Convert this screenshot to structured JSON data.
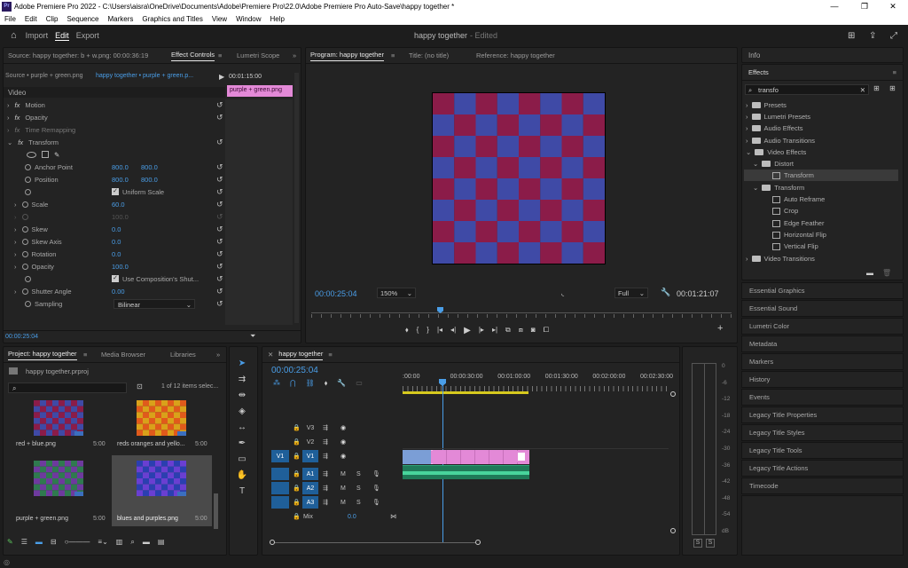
{
  "window": {
    "title": "Adobe Premiere Pro 2022 - C:\\Users\\aisra\\OneDrive\\Documents\\Adobe\\Premiere Pro\\22.0\\Adobe Premiere Pro Auto-Save\\happy together *"
  },
  "menu": [
    "File",
    "Edit",
    "Clip",
    "Sequence",
    "Markers",
    "Graphics and Titles",
    "View",
    "Window",
    "Help"
  ],
  "workspace": {
    "import": "Import",
    "edit": "Edit",
    "export": "Export",
    "project": "happy together",
    "status": "- Edited"
  },
  "effect_controls": {
    "source": "Source: happy together: b + w.png: 00:00:36:19",
    "tab_effect": "Effect Controls",
    "tab_lumetri": "Lumetri Scope",
    "crumb_source": "Source • purple + green.png",
    "crumb_seq": "happy together • purple + green.p...",
    "mini_time": "00:01:15:00",
    "clip": "purple + green.png",
    "video": "Video",
    "motion": "Motion",
    "opacity": "Opacity",
    "time_remap": "Time Remapping",
    "transform": "Transform",
    "anchor": "Anchor Point",
    "anchor_x": "800.0",
    "anchor_y": "800.0",
    "position": "Position",
    "pos_x": "800.0",
    "pos_y": "800.0",
    "uniform": "Uniform Scale",
    "scale": "Scale",
    "scale_val": "60.0",
    "scale_w": "100.0",
    "skew": "Skew",
    "skew_val": "0.0",
    "skew_axis": "Skew Axis",
    "skew_axis_val": "0.0",
    "rotation": "Rotation",
    "rotation_val": "0.0",
    "opacity2": "Opacity",
    "opacity_val": "100.0",
    "comp_shutter": "Use Composition's Shut...",
    "shutter": "Shutter Angle",
    "shutter_val": "0.00",
    "sampling": "Sampling",
    "sampling_val": "Bilinear",
    "timecode": "00:00:25:04"
  },
  "program": {
    "tab": "Program: happy together",
    "title": "Title: (no title)",
    "reference": "Reference: happy together",
    "timecode": "00:00:25:04",
    "zoom": "150%",
    "quality": "Full",
    "duration": "00:01:21:07"
  },
  "effects": {
    "info": "Info",
    "title": "Effects",
    "search": "transfo",
    "items": [
      "Presets",
      "Lumetri Presets",
      "Audio Effects",
      "Audio Transitions",
      "Video Effects",
      "Distort",
      "Transform",
      "Transform",
      "Auto Reframe",
      "Crop",
      "Edge Feather",
      "Horizontal Flip",
      "Vertical Flip",
      "Video Transitions"
    ]
  },
  "side_tabs": [
    "Essential Graphics",
    "Essential Sound",
    "Lumetri Color",
    "Metadata",
    "Markers",
    "History",
    "Events",
    "Legacy Title Properties",
    "Legacy Title Styles",
    "Legacy Title Tools",
    "Legacy Title Actions",
    "Timecode"
  ],
  "project": {
    "tab": "Project: happy together",
    "media": "Media Browser",
    "libraries": "Libraries",
    "file": "happy together.prproj",
    "count": "1 of 12 items selec...",
    "items": [
      {
        "name": "red + blue.png",
        "dur": "5:00"
      },
      {
        "name": "reds oranges and yello...",
        "dur": "5:00"
      },
      {
        "name": "purple + green.png",
        "dur": "5:00"
      },
      {
        "name": "blues and purples.png",
        "dur": "5:00"
      }
    ]
  },
  "timeline": {
    "tab": "happy together",
    "timecode": "00:00:25:04",
    "ruler": [
      ":00:00",
      "00:00:30:00",
      "00:01:00:00",
      "00:01:30:00",
      "00:02:00:00",
      "00:02:30:00"
    ],
    "v_tracks": [
      "V3",
      "V2",
      "V1"
    ],
    "a_tracks": [
      "A1",
      "A2",
      "A3"
    ],
    "source_v": "V1",
    "mix": "Mix",
    "mix_val": "0.0",
    "mute": "M",
    "solo": "S"
  },
  "meter": {
    "labels": [
      "0",
      "-6",
      "-12",
      "-18",
      "-24",
      "-30",
      "-36",
      "-42",
      "-48",
      "-54",
      "dB"
    ],
    "solo": "S"
  },
  "colors": {
    "accent": "#4a9ee8",
    "clip_pink": "#e389d7",
    "clip_blue": "#7b9ed6",
    "audio_green": "#2fa37a",
    "checker_a": "#3f4aa6",
    "checker_b": "#8b1c49"
  }
}
